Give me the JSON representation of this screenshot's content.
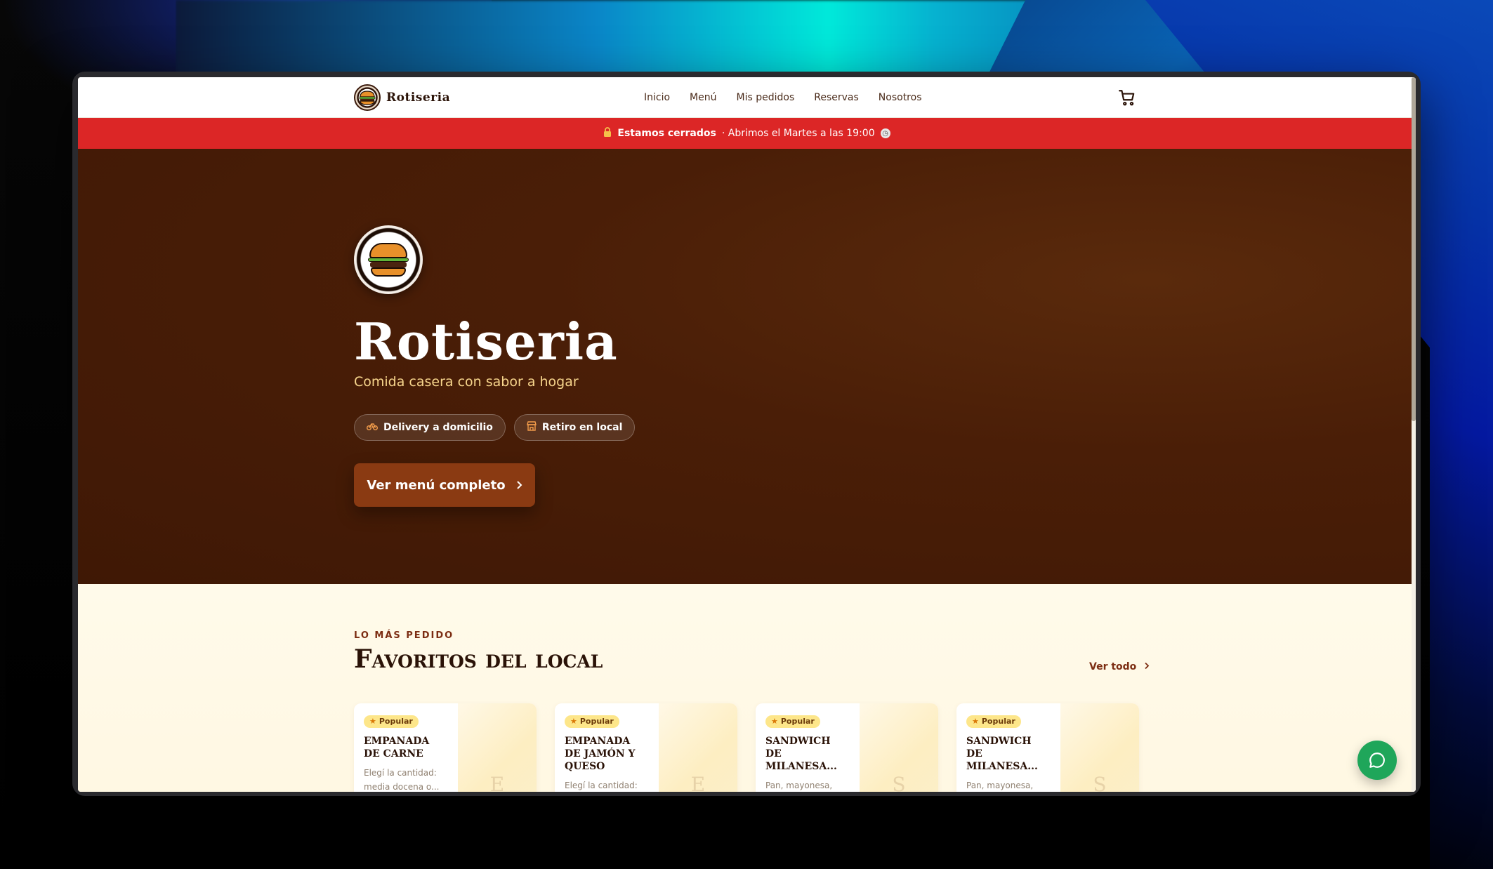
{
  "brand": {
    "name": "Rotiseria"
  },
  "nav": {
    "links": [
      "Inicio",
      "Menú",
      "Mis pedidos",
      "Reservas",
      "Nosotros"
    ]
  },
  "banner": {
    "status": "Estamos cerrados",
    "reopen": "· Abrimos el Martes a las 19:00"
  },
  "hero": {
    "title": "Rotiseria",
    "subtitle": "Comida casera con sabor a hogar",
    "chips": [
      "Delivery a domicilio",
      "Retiro en local"
    ],
    "cta": "Ver menú completo"
  },
  "favorites": {
    "kicker": "LO MÁS PEDIDO",
    "title": "Favoritos del local",
    "see_all": "Ver todo",
    "items": [
      {
        "badge": "Popular",
        "name": "Empanada de carne",
        "desc": "Elegí la cantidad: media docena o...",
        "thumb_letter": "E"
      },
      {
        "badge": "Popular",
        "name": "Empanada de jamón y queso",
        "desc": "Elegí la cantidad: media docena o...",
        "thumb_letter": "E"
      },
      {
        "badge": "Popular",
        "name": "Sandwich de milanesa...",
        "desc": "Pan, mayonesa, milanesa, queso,...",
        "thumb_letter": "S"
      },
      {
        "badge": "Popular",
        "name": "Sandwich de milanesa...",
        "desc": "Pan, mayonesa, milanesa, queso,...",
        "thumb_letter": "S"
      }
    ]
  },
  "colors": {
    "banner_red": "#dc2626",
    "hero_brown": "#4a1e07",
    "cta_brown": "#8a3a12",
    "accent_gold": "#f7d58c",
    "chat_green": "#1fa65a"
  },
  "icons": {
    "cart": "cart-icon",
    "lock": "lock-icon",
    "clock": "clock-icon",
    "bike": "bike-icon",
    "store": "store-icon",
    "chevron": "chevron-right-icon",
    "chat": "chat-icon",
    "star": "star-icon"
  }
}
